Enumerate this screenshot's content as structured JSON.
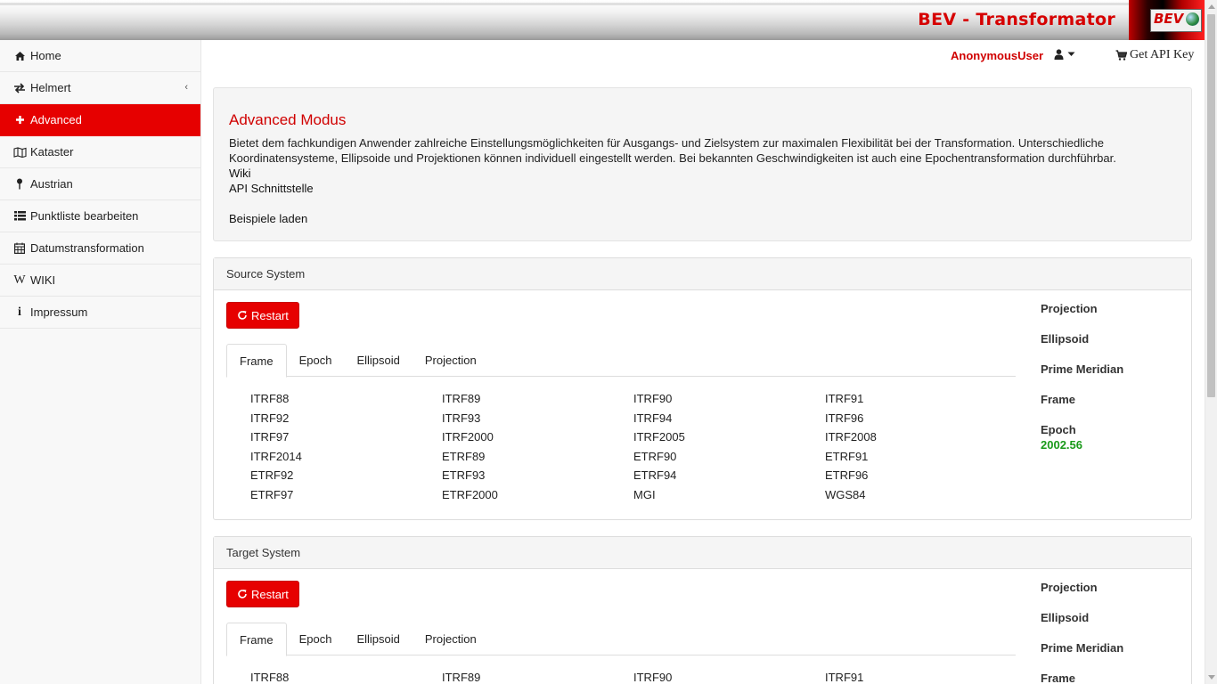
{
  "header": {
    "title": "BEV - Transformator",
    "logo_text": "BEV"
  },
  "sidebar": {
    "items": [
      {
        "label": "Home",
        "icon": "home-icon"
      },
      {
        "label": "Helmert",
        "icon": "exchange-icon",
        "has_submenu": true
      },
      {
        "label": "Advanced",
        "icon": "plus-icon",
        "active": true
      },
      {
        "label": "Kataster",
        "icon": "map-icon"
      },
      {
        "label": "Austrian",
        "icon": "pin-icon"
      },
      {
        "label": "Punktliste bearbeiten",
        "icon": "list-icon"
      },
      {
        "label": "Datumstransformation",
        "icon": "calendar-icon"
      },
      {
        "label": "WIKI",
        "icon": "wikipedia-icon"
      },
      {
        "label": "Impressum",
        "icon": "info-icon"
      }
    ]
  },
  "topnav": {
    "user": "AnonymousUser",
    "api_key": "Get API Key"
  },
  "info": {
    "title": "Advanced Modus",
    "text": "Bietet dem fachkundigen Anwender zahlreiche Einstellungsmöglichkeiten für Ausgangs- und Zielsystem zur maximalen Flexibilität bei der Transformation. Unterschiedliche Koordinatensysteme, Ellipsoide und Projektionen können individuell eingestellt werden. Bei bekannten Geschwindigkeiten ist auch eine Epochentransformation durchführbar.",
    "wiki": "Wiki",
    "api": "API Schnittstelle",
    "examples": "Beispiele laden"
  },
  "source": {
    "heading": "Source System",
    "restart": "Restart",
    "tabs": [
      "Frame",
      "Epoch",
      "Ellipsoid",
      "Projection"
    ],
    "frames": [
      "ITRF88",
      "ITRF89",
      "ITRF90",
      "ITRF91",
      "ITRF92",
      "ITRF93",
      "ITRF94",
      "ITRF96",
      "ITRF97",
      "ITRF2000",
      "ITRF2005",
      "ITRF2008",
      "ITRF2014",
      "ETRF89",
      "ETRF90",
      "ETRF91",
      "ETRF92",
      "ETRF93",
      "ETRF94",
      "ETRF96",
      "ETRF97",
      "ETRF2000",
      "MGI",
      "WGS84"
    ],
    "summary": {
      "projection": "Projection",
      "ellipsoid": "Ellipsoid",
      "prime_meridian": "Prime Meridian",
      "frame": "Frame",
      "epoch": "Epoch",
      "epoch_value": "2002.56"
    }
  },
  "target": {
    "heading": "Target System",
    "restart": "Restart",
    "tabs": [
      "Frame",
      "Epoch",
      "Ellipsoid",
      "Projection"
    ],
    "frames": [
      "ITRF88",
      "ITRF89",
      "ITRF90",
      "ITRF91"
    ],
    "summary": {
      "projection": "Projection",
      "ellipsoid": "Ellipsoid",
      "prime_meridian": "Prime Meridian",
      "frame": "Frame"
    }
  },
  "colors": {
    "brand_red": "#e60000",
    "epoch_green": "#1a9a1a"
  }
}
